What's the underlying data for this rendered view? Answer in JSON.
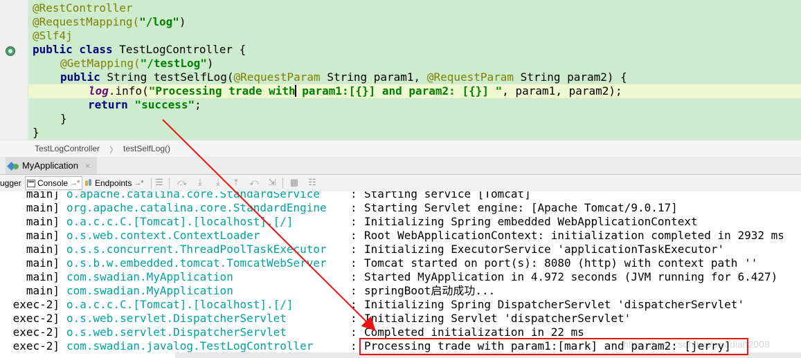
{
  "editor": {
    "lines": {
      "l1": "@RestController",
      "l2_ann": "@RequestMapping(",
      "l2_str": "\"/log\"",
      "l2_end": ")",
      "l3": "@Slf4j",
      "l4_kw": "public class",
      "l4_rest": " TestLogController {",
      "l5_ann": "@GetMapping(",
      "l5_str": "\"/testLog\"",
      "l5_end": ")",
      "l6_kw": "public",
      "l6_a": " String testSelfLog(",
      "l6_ann1": "@RequestParam",
      "l6_b": " String param1, ",
      "l6_ann2": "@RequestParam",
      "l6_c": " String param2) {",
      "l7_log": "log",
      "l7_a": ".info(",
      "l7_str1": "\"Processing trade with",
      "l7_str2": " param1:[{}] and param2: [{}] \"",
      "l7_b": ", param1, param2);",
      "l8_kw": "return",
      "l8_str": " \"success\"",
      "l8_end": ";",
      "l9": "}",
      "l10": "}"
    }
  },
  "breadcrumb": {
    "class_name": "TestLogController",
    "separator": "〉",
    "method_name": "testSelfLog()"
  },
  "run_tab": {
    "label": "MyApplication",
    "close": "×"
  },
  "toolbar": {
    "debugger": "ugger",
    "console": "Console",
    "endpoints": "Endpoints",
    "pin": "→*"
  },
  "console": {
    "rows": [
      {
        "thread": "main]",
        "logger": "o.apache.catalina.core.StandardService",
        "msg": "Starting service [Tomcat]"
      },
      {
        "thread": "main]",
        "logger": "org.apache.catalina.core.StandardEngine",
        "msg": "Starting Servlet engine: [Apache Tomcat/9.0.17]"
      },
      {
        "thread": "main]",
        "logger": "o.a.c.c.C.[Tomcat].[localhost].[/]",
        "msg": "Initializing Spring embedded WebApplicationContext"
      },
      {
        "thread": "main]",
        "logger": "o.s.web.context.ContextLoader",
        "msg": "Root WebApplicationContext: initialization completed in 2932 ms"
      },
      {
        "thread": "main]",
        "logger": "o.s.s.concurrent.ThreadPoolTaskExecutor",
        "msg": "Initializing ExecutorService 'applicationTaskExecutor'"
      },
      {
        "thread": "main]",
        "logger": "o.s.b.w.embedded.tomcat.TomcatWebServer",
        "msg": "Tomcat started on port(s): 8080 (http) with context path ''"
      },
      {
        "thread": "main]",
        "logger": "com.swadian.MyApplication",
        "msg": "Started MyApplication in 4.972 seconds (JVM running for 6.427)"
      },
      {
        "thread": "main]",
        "logger": "com.swadian.MyApplication",
        "msg": "springBoot启动成功..."
      },
      {
        "thread": "exec-2]",
        "logger": "o.a.c.c.C.[Tomcat].[localhost].[/]",
        "msg": "Initializing Spring DispatcherServlet 'dispatcherServlet'"
      },
      {
        "thread": "exec-2]",
        "logger": "o.s.web.servlet.DispatcherServlet",
        "msg": "Initializing Servlet 'dispatcherServlet'"
      },
      {
        "thread": "exec-2]",
        "logger": "o.s.web.servlet.DispatcherServlet",
        "msg": "Completed initialization in 22 ms"
      },
      {
        "thread": "exec-2]",
        "logger": "com.swadian.javalog.TestLogController",
        "msg": "Processing trade with param1:[mark] and param2: [jerry]"
      }
    ],
    "colon": ":"
  },
  "colors": {
    "annotation": "#808000",
    "keyword": "#000080",
    "string": "#008000",
    "logger": "#00a1a1",
    "highlight_box": "#ee1111",
    "arrow": "#ee1111"
  }
}
